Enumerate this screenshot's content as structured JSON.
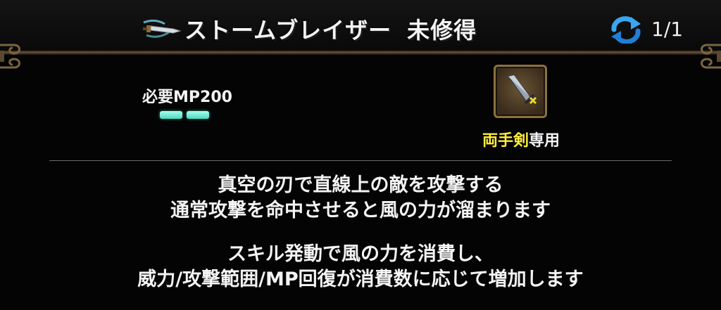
{
  "header": {
    "skill_name": "ストームブレイザー",
    "status": "未修得",
    "page_indicator": "1/1",
    "skill_icon": "wind-sword-icon",
    "cycle_icon": "cycle-arrows-icon"
  },
  "requirements": {
    "mp_label": "必要MP200",
    "mp_pip_count": 2
  },
  "weapon": {
    "icon": "two-handed-sword-icon",
    "type": "両手剣",
    "only": "専用"
  },
  "description": {
    "line1": "真空の刃で直線上の敵を攻撃する",
    "line2": "通常攻撃を命中させると風の力が溜まります",
    "line3": "スキル発動で風の力を消費し、",
    "line4": "威力/攻撃範囲/MP回復が消費数に応じて増加します"
  },
  "colors": {
    "weapon_type": "#ffee3c",
    "mp_pip": "#6fe8d2",
    "frame_gold": "#8a7140"
  }
}
